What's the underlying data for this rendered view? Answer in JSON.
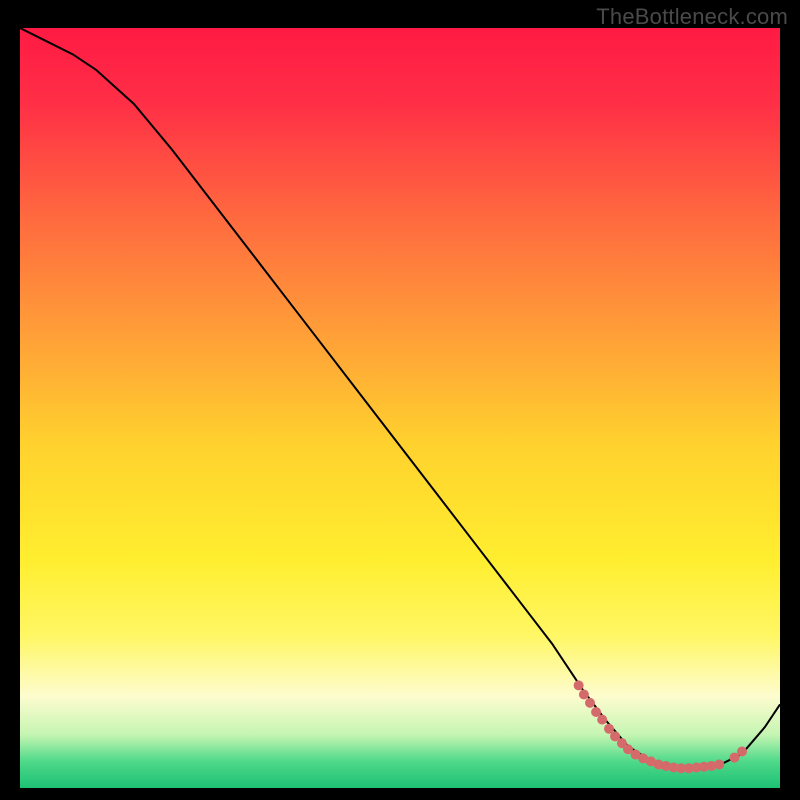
{
  "watermark": "TheBottleneck.com",
  "chart_data": {
    "type": "line",
    "title": "",
    "xlabel": "",
    "ylabel": "",
    "xlim": [
      0,
      100
    ],
    "ylim": [
      0,
      100
    ],
    "grid": false,
    "background_gradient": {
      "angle_deg": 0,
      "stops": [
        {
          "offset": 0.0,
          "color": "#ff1a44"
        },
        {
          "offset": 0.1,
          "color": "#ff2f46"
        },
        {
          "offset": 0.25,
          "color": "#ff6a3f"
        },
        {
          "offset": 0.4,
          "color": "#ff9e38"
        },
        {
          "offset": 0.55,
          "color": "#ffd22e"
        },
        {
          "offset": 0.7,
          "color": "#ffee2f"
        },
        {
          "offset": 0.8,
          "color": "#fff765"
        },
        {
          "offset": 0.88,
          "color": "#fdfccf"
        },
        {
          "offset": 0.93,
          "color": "#c5f5b2"
        },
        {
          "offset": 0.965,
          "color": "#4fd98a"
        },
        {
          "offset": 1.0,
          "color": "#1dc074"
        }
      ]
    },
    "series": [
      {
        "name": "bottleneck-curve",
        "color": "#000000",
        "stroke_width": 2,
        "x": [
          0,
          4,
          7,
          10,
          15,
          20,
          25,
          30,
          35,
          40,
          45,
          50,
          55,
          60,
          65,
          70,
          74,
          77,
          80,
          83,
          86,
          89,
          92,
          95,
          98,
          100
        ],
        "y": [
          100,
          98,
          96.5,
          94.5,
          90,
          84,
          77.5,
          71,
          64.5,
          58,
          51.5,
          45,
          38.5,
          32,
          25.5,
          19,
          13,
          9,
          5.5,
          3.6,
          2.7,
          2.6,
          3.0,
          4.5,
          8,
          11
        ]
      }
    ],
    "valley_markers": {
      "color": "#d46a6a",
      "radius": 5,
      "points": [
        {
          "x": 73.5,
          "y": 13.5
        },
        {
          "x": 74.2,
          "y": 12.3
        },
        {
          "x": 75.0,
          "y": 11.2
        },
        {
          "x": 75.8,
          "y": 10.0
        },
        {
          "x": 76.6,
          "y": 9.0
        },
        {
          "x": 77.5,
          "y": 7.8
        },
        {
          "x": 78.3,
          "y": 6.8
        },
        {
          "x": 79.2,
          "y": 5.9
        },
        {
          "x": 80.0,
          "y": 5.1
        },
        {
          "x": 81.0,
          "y": 4.4
        },
        {
          "x": 82.0,
          "y": 3.9
        },
        {
          "x": 83.0,
          "y": 3.5
        },
        {
          "x": 84.0,
          "y": 3.1
        },
        {
          "x": 85.0,
          "y": 2.9
        },
        {
          "x": 86.0,
          "y": 2.7
        },
        {
          "x": 87.0,
          "y": 2.6
        },
        {
          "x": 88.0,
          "y": 2.6
        },
        {
          "x": 89.0,
          "y": 2.7
        },
        {
          "x": 90.0,
          "y": 2.8
        },
        {
          "x": 91.0,
          "y": 2.9
        },
        {
          "x": 92.0,
          "y": 3.1
        },
        {
          "x": 94.0,
          "y": 4.0
        },
        {
          "x": 95.0,
          "y": 4.8
        }
      ]
    }
  }
}
